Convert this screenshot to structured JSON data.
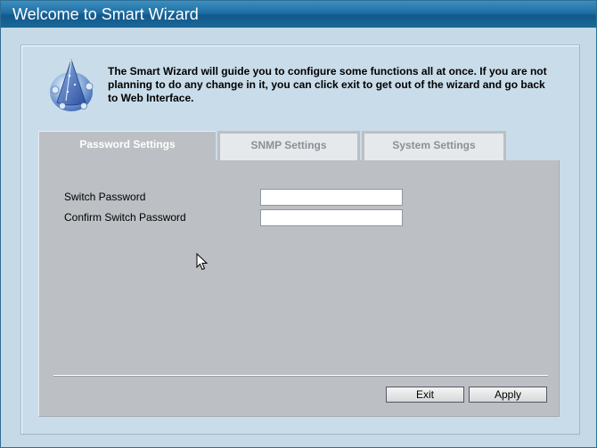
{
  "window": {
    "title": "Welcome to Smart Wizard"
  },
  "intro": {
    "text": "The Smart Wizard will guide you to configure some functions all at once. If you are not planning to do any change in it, you can click exit to get out of the wizard and go back to Web Interface."
  },
  "tabs": [
    {
      "label": "Password Settings",
      "active": true
    },
    {
      "label": "SNMP Settings",
      "active": false
    },
    {
      "label": "System Settings",
      "active": false
    }
  ],
  "form": {
    "switch_password": {
      "label": "Switch Password",
      "value": ""
    },
    "confirm_password": {
      "label": "Confirm Switch Password",
      "value": ""
    }
  },
  "buttons": {
    "exit": "Exit",
    "apply": "Apply"
  },
  "icons": {
    "wizard": "wizard-hat-icon",
    "cursor": "mouse-pointer-icon"
  },
  "colors": {
    "titlebar": "#1f6ea3",
    "background": "#c9dce9",
    "tab_active": "#bcbfc3",
    "tab_inactive": "#e6e9ec"
  }
}
